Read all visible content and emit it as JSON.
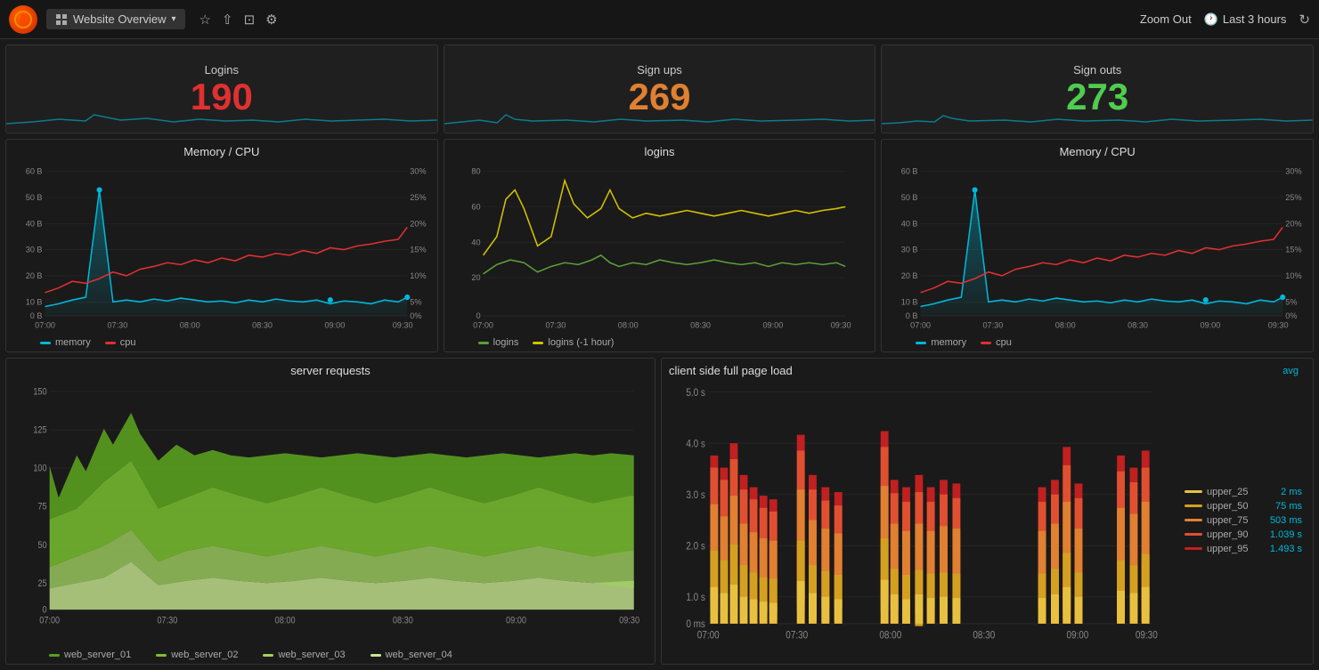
{
  "topbar": {
    "logo": "G",
    "title": "Website Overview",
    "zoom_out": "Zoom Out",
    "time_range": "Last 3 hours",
    "icons": [
      "grid-icon",
      "star-icon",
      "share-icon",
      "save-icon",
      "gear-icon"
    ]
  },
  "stats": [
    {
      "id": "logins",
      "title": "Logins",
      "value": "190",
      "color": "red"
    },
    {
      "id": "signups",
      "title": "Sign ups",
      "value": "269",
      "color": "orange"
    },
    {
      "id": "signouts",
      "title": "Sign outs",
      "value": "273",
      "color": "green"
    }
  ],
  "charts_row2": [
    {
      "id": "memory-cpu-left",
      "title": "Memory / CPU",
      "legend": [
        {
          "label": "memory",
          "color": "#00b8d9"
        },
        {
          "label": "cpu",
          "color": "#e03030"
        }
      ],
      "y_left": [
        "60 B",
        "50 B",
        "40 B",
        "30 B",
        "20 B",
        "10 B",
        "0 B"
      ],
      "y_right": [
        "30%",
        "25%",
        "20%",
        "15%",
        "10%",
        "5%",
        "0%"
      ],
      "x_labels": [
        "07:00",
        "07:30",
        "08:00",
        "08:30",
        "09:00",
        "09:30"
      ]
    },
    {
      "id": "logins-chart",
      "title": "logins",
      "legend": [
        {
          "label": "logins",
          "color": "#5c9e3a"
        },
        {
          "label": "logins (-1 hour)",
          "color": "#d4c200"
        }
      ],
      "y_labels": [
        "80",
        "60",
        "40",
        "20",
        "0"
      ],
      "x_labels": [
        "07:00",
        "07:30",
        "08:00",
        "08:30",
        "09:00",
        "09:30"
      ]
    },
    {
      "id": "memory-cpu-right",
      "title": "Memory / CPU",
      "legend": [
        {
          "label": "memory",
          "color": "#00b8d9"
        },
        {
          "label": "cpu",
          "color": "#e03030"
        }
      ],
      "y_left": [
        "60 B",
        "50 B",
        "40 B",
        "30 B",
        "20 B",
        "10 B",
        "0 B"
      ],
      "y_right": [
        "30%",
        "25%",
        "20%",
        "15%",
        "10%",
        "5%",
        "0%"
      ],
      "x_labels": [
        "07:00",
        "07:30",
        "08:00",
        "08:30",
        "09:00",
        "09:30"
      ]
    }
  ],
  "server_requests": {
    "title": "server requests",
    "y_labels": [
      "150",
      "125",
      "100",
      "75",
      "50",
      "25",
      "0"
    ],
    "x_labels": [
      "07:00",
      "07:30",
      "08:00",
      "08:30",
      "09:00",
      "09:30"
    ],
    "legend": [
      {
        "label": "web_server_01",
        "color": "#5a9e20"
      },
      {
        "label": "web_server_02",
        "color": "#7ac030"
      },
      {
        "label": "web_server_03",
        "color": "#a0d060"
      },
      {
        "label": "web_server_04",
        "color": "#c8e890"
      }
    ]
  },
  "client_page_load": {
    "title": "client side full page load",
    "avg_label": "avg",
    "y_labels": [
      "5.0 s",
      "4.0 s",
      "3.0 s",
      "2.0 s",
      "1.0 s",
      "0 ms"
    ],
    "x_labels": [
      "07:00",
      "07:30",
      "08:00",
      "08:30",
      "09:00",
      "09:30"
    ],
    "legend": [
      {
        "label": "upper_25",
        "value": "2 ms",
        "color": "#e8c040"
      },
      {
        "label": "upper_50",
        "value": "75 ms",
        "color": "#d4a020"
      },
      {
        "label": "upper_75",
        "value": "503 ms",
        "color": "#e08030"
      },
      {
        "label": "upper_90",
        "value": "1.039 s",
        "color": "#e05030"
      },
      {
        "label": "upper_95",
        "value": "1.493 s",
        "color": "#c02020"
      }
    ]
  }
}
